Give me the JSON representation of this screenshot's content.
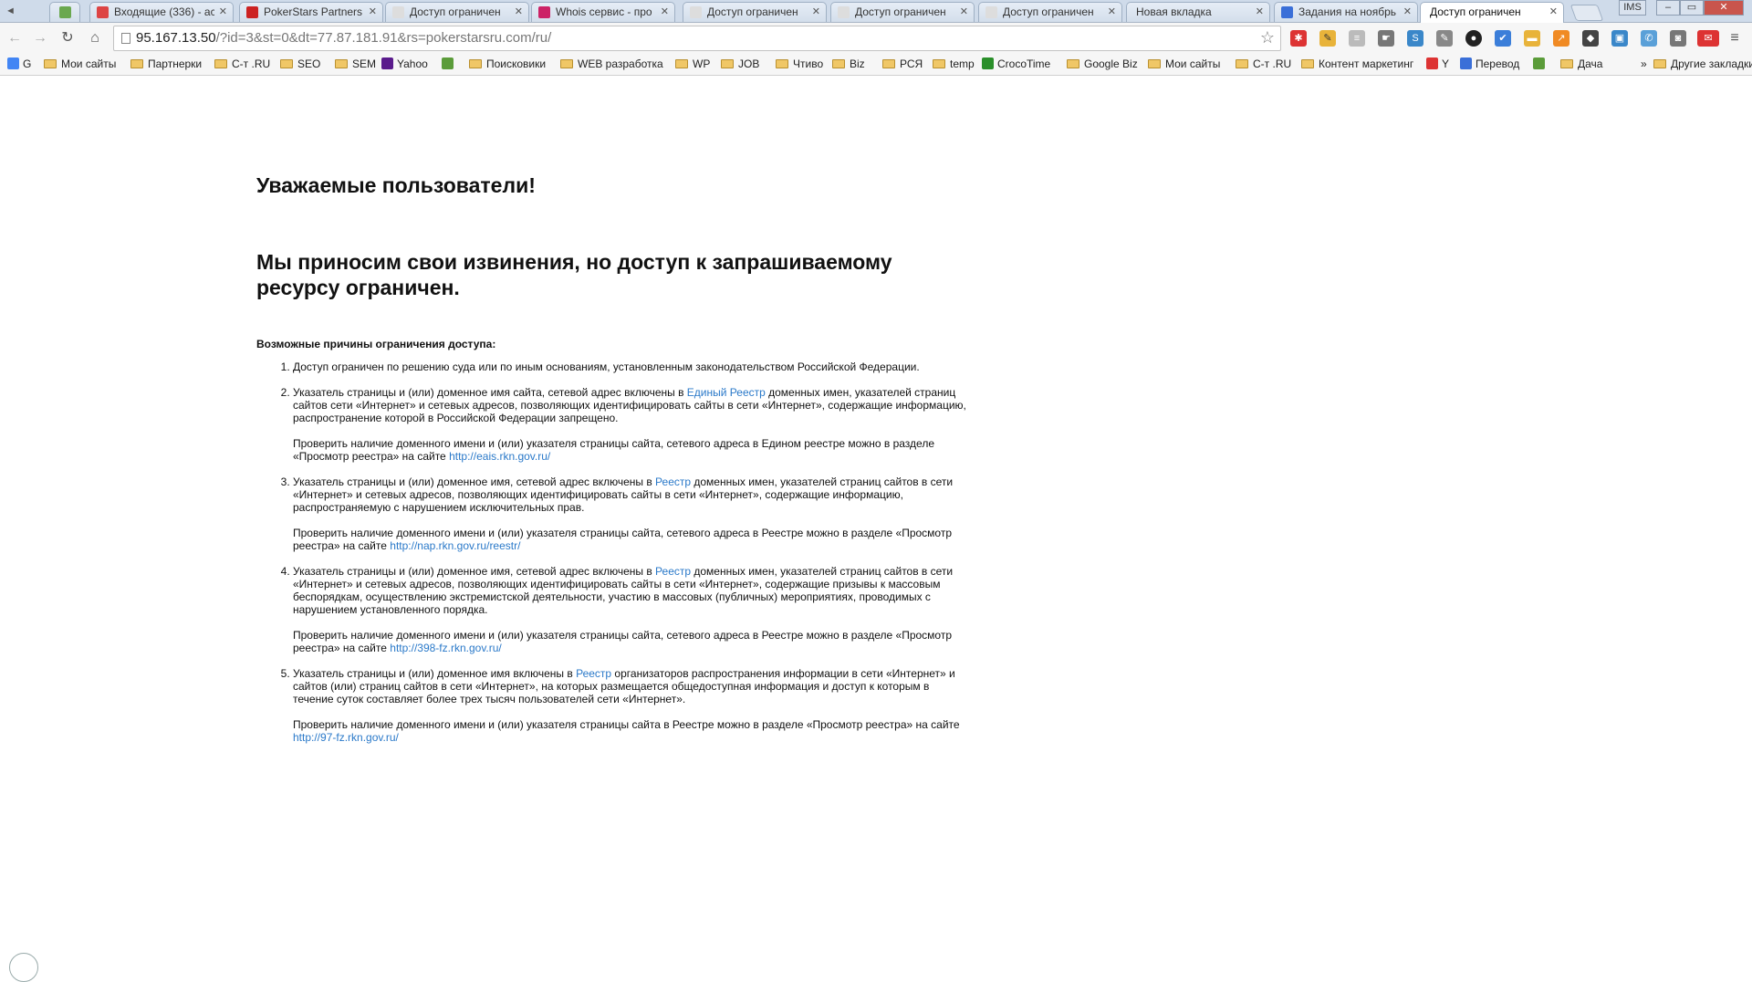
{
  "tabs": [
    {
      "title": "Входящие (336) - ac",
      "fav_color": "#d44"
    },
    {
      "title": "PokerStars Partners",
      "fav_color": "#c22"
    },
    {
      "title": "Доступ ограничен",
      "fav_color": "#ddd"
    },
    {
      "title": "Whois сервис - про",
      "fav_color": "#c26"
    },
    {
      "title": "Доступ ограничен",
      "fav_color": "#ddd"
    },
    {
      "title": "Доступ ограничен",
      "fav_color": "#ddd"
    },
    {
      "title": "Доступ ограничен",
      "fav_color": "#ddd"
    },
    {
      "title": "Новая вкладка",
      "fav_color": ""
    },
    {
      "title": "Задания на ноябрь",
      "fav_color": "#3a6fd8"
    },
    {
      "title": "Доступ ограничен",
      "fav_color": "",
      "active": true
    }
  ],
  "window": {
    "user_label": "IMS",
    "minimize": "–",
    "maximize": "▭",
    "close": "✕"
  },
  "toolbar": {
    "url_host": "95.167.13.50",
    "url_rest": "/?id=3&st=0&dt=77.87.181.91&rs=pokerstarsru.com/ru/"
  },
  "bookmarks": [
    {
      "label": "G",
      "type": "icon"
    },
    {
      "label": "Мои сайты",
      "type": "folder"
    },
    {
      "label": "Партнерки",
      "type": "folder"
    },
    {
      "label": "С-т .RU",
      "type": "folder"
    },
    {
      "label": "SEO",
      "type": "folder"
    },
    {
      "label": "SEM",
      "type": "folder"
    },
    {
      "label": "Yahoo",
      "type": "icon"
    },
    {
      "label": "",
      "type": "icon"
    },
    {
      "label": "Поисковики",
      "type": "folder"
    },
    {
      "label": "WEB разработка",
      "type": "folder"
    },
    {
      "label": "WP",
      "type": "folder"
    },
    {
      "label": "JOB",
      "type": "folder"
    },
    {
      "label": "Чтиво",
      "type": "folder"
    },
    {
      "label": "Biz",
      "type": "folder"
    },
    {
      "label": "РСЯ",
      "type": "folder"
    },
    {
      "label": "temp",
      "type": "folder"
    },
    {
      "label": "CrocoTime",
      "type": "icon"
    },
    {
      "label": "Google Biz",
      "type": "folder"
    },
    {
      "label": "Мои сайты",
      "type": "folder"
    },
    {
      "label": "С-т .RU",
      "type": "folder"
    },
    {
      "label": "Контент маркетинг",
      "type": "folder"
    },
    {
      "label": "Y",
      "type": "icon"
    },
    {
      "label": "Перевод",
      "type": "icon"
    },
    {
      "label": "",
      "type": "icon"
    },
    {
      "label": "Дача",
      "type": "folder"
    }
  ],
  "bookmarks_more": "»",
  "other_bookmarks": "Другие закладки",
  "page": {
    "heading1": "Уважаемые пользователи!",
    "heading2": "Мы приносим свои извинения, но доступ к запрашиваемому ресурсу ограничен.",
    "reasons_title": "Возможные причины ограничения доступа:",
    "reasons": [
      {
        "text": "Доступ ограничен  по решению суда или по иным основаниям, установленным законодательством Российской Федерации."
      },
      {
        "pre": "Указатель страницы и (или) доменное имя сайта, сетевой адрес включены в ",
        "link": "Единый Реестр",
        "post": " доменных имен, указателей страниц сайтов сети «Интернет» и сетевых адресов, позволяющих идентифицировать сайты в сети «Интернет», содержащие информацию, распространение которой в Российской Федерации запрещено.",
        "check": "Проверить наличие доменного имени и (или) указателя страницы сайта, сетевого адреса в Едином реестре можно в разделе «Просмотр реестра» на сайте ",
        "check_link": "http://eais.rkn.gov.ru/"
      },
      {
        "pre": "Указатель страницы и (или) доменное имя, сетевой адрес включены в ",
        "link": "Реестр",
        "post": " доменных имен, указателей страниц сайтов в сети «Интернет» и сетевых адресов, позволяющих идентифицировать сайты в сети «Интернет», содержащие информацию, распространяемую с нарушением исключительных прав.",
        "check": "Проверить наличие доменного имени и (или) указателя страницы сайта, сетевого адреса в Реестре можно в разделе «Просмотр реестра» на сайте ",
        "check_link": "http://nap.rkn.gov.ru/reestr/"
      },
      {
        "pre": "Указатель страницы и (или) доменное имя, сетевой адрес включены в ",
        "link": "Реестр",
        "post": " доменных имен, указателей страниц сайтов в сети «Интернет» и сетевых адресов, позволяющих идентифицировать сайты в сети «Интернет», содержащие призывы к массовым беспорядкам, осуществлению экстремистской деятельности, участию в массовых (публичных) мероприятиях, проводимых с нарушением установленного порядка.",
        "check": "Проверить наличие доменного имени и (или) указателя страницы сайта, сетевого адреса в Реестре можно в разделе «Просмотр реестра» на сайте ",
        "check_link": "http://398-fz.rkn.gov.ru/"
      },
      {
        "pre": "Указатель страницы и (или) доменное имя включены в ",
        "link": "Реестр",
        "post": " организаторов распространения информации в сети «Интернет» и сайтов (или) страниц сайтов в сети «Интернет», на которых размещается общедоступная информация и доступ к которым в течение суток составляет более трех тысяч пользователей сети «Интернет».",
        "check": "Проверить наличие доменного имени и (или) указателя страницы сайта в Реестре можно в разделе «Просмотр реестра» на сайте ",
        "check_link": "http://97-fz.rkn.gov.ru/"
      }
    ]
  },
  "colors": {
    "link": "#2a79c9",
    "tabstrip": "#cfdbea"
  }
}
